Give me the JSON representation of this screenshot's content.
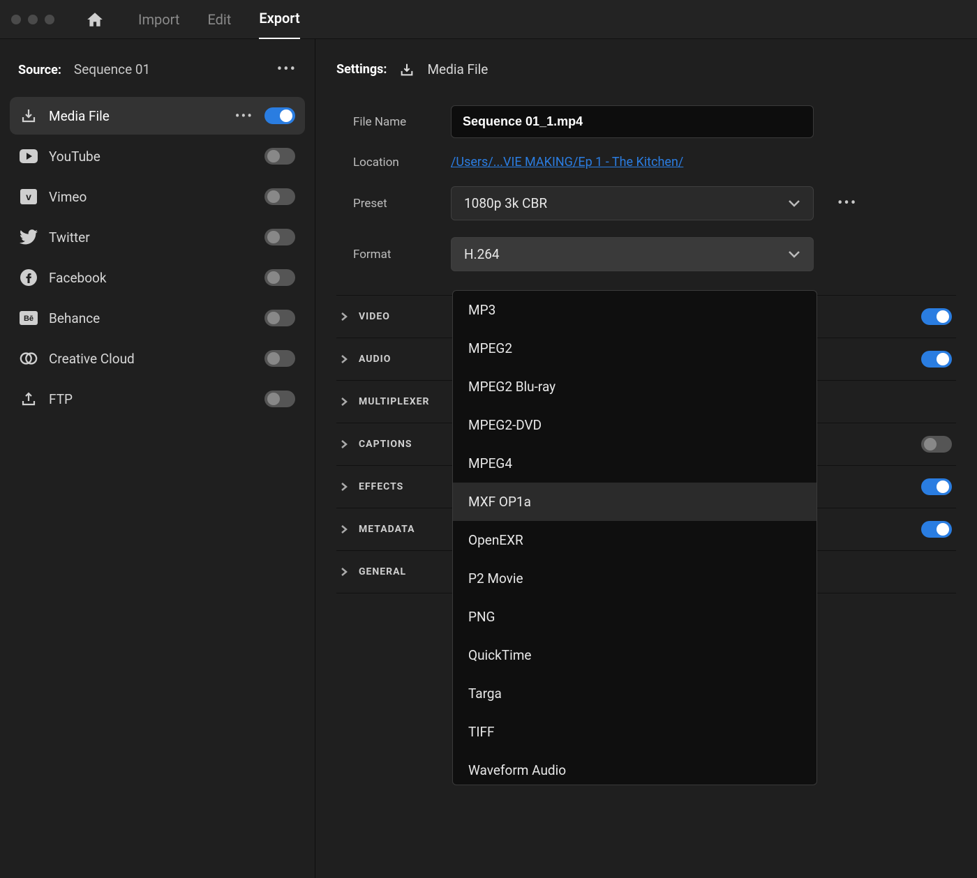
{
  "tabs": {
    "import": "Import",
    "edit": "Edit",
    "export": "Export"
  },
  "source": {
    "label": "Source:",
    "name": "Sequence 01"
  },
  "destinations": [
    {
      "id": "media-file",
      "label": "Media File",
      "on": true,
      "selected": true,
      "icon": "download"
    },
    {
      "id": "youtube",
      "label": "YouTube",
      "on": false,
      "icon": "youtube"
    },
    {
      "id": "vimeo",
      "label": "Vimeo",
      "on": false,
      "icon": "vimeo"
    },
    {
      "id": "twitter",
      "label": "Twitter",
      "on": false,
      "icon": "twitter"
    },
    {
      "id": "facebook",
      "label": "Facebook",
      "on": false,
      "icon": "facebook"
    },
    {
      "id": "behance",
      "label": "Behance",
      "on": false,
      "icon": "behance"
    },
    {
      "id": "cc",
      "label": "Creative Cloud",
      "on": false,
      "icon": "cc"
    },
    {
      "id": "ftp",
      "label": "FTP",
      "on": false,
      "icon": "ftp"
    }
  ],
  "settings": {
    "label": "Settings:",
    "destName": "Media File",
    "fileNameLabel": "File Name",
    "fileName": "Sequence 01_1.mp4",
    "locationLabel": "Location",
    "locationPath": "/Users/...VIE MAKING/Ep 1 - The Kitchen/",
    "presetLabel": "Preset",
    "presetValue": "1080p 3k CBR",
    "formatLabel": "Format",
    "formatValue": "H.264"
  },
  "accordions": [
    {
      "id": "video",
      "label": "VIDEO",
      "on": true
    },
    {
      "id": "audio",
      "label": "AUDIO",
      "on": true
    },
    {
      "id": "multiplexer",
      "label": "MULTIPLEXER",
      "on": null
    },
    {
      "id": "captions",
      "label": "CAPTIONS",
      "on": false
    },
    {
      "id": "effects",
      "label": "EFFECTS",
      "on": true
    },
    {
      "id": "metadata",
      "label": "METADATA",
      "on": true
    },
    {
      "id": "general",
      "label": "GENERAL",
      "on": null
    }
  ],
  "formatOptions": [
    "MP3",
    "MPEG2",
    "MPEG2 Blu-ray",
    "MPEG2-DVD",
    "MPEG4",
    "MXF OP1a",
    "OpenEXR",
    "P2 Movie",
    "PNG",
    "QuickTime",
    "Targa",
    "TIFF",
    "Waveform Audio"
  ],
  "formatHoverIndex": 5
}
